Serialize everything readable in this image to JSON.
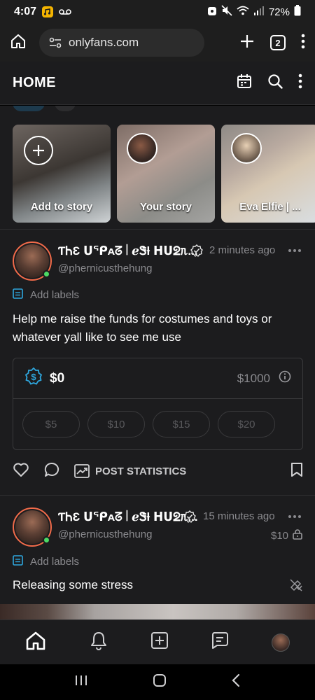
{
  "status_bar": {
    "time": "4:07",
    "battery": "72%"
  },
  "browser": {
    "url": "onlyfans.com",
    "tab_count": "2"
  },
  "header": {
    "title": "HOME"
  },
  "stories": [
    {
      "label": "Add to story"
    },
    {
      "label": "Your story"
    },
    {
      "label": "Eva Elfie | ..."
    }
  ],
  "posts": [
    {
      "display_name": "ƬᏂƐ ᑌᕿᴀᘔ꒐ℯᏕƚ ᕼᑌᘖᥰ...",
      "handle": "@phernicusthehung",
      "time": "2 minutes ago",
      "add_labels": "Add labels",
      "text": "Help me raise the funds for costumes and toys or whatever yall like to see me use",
      "fundraiser": {
        "raised": "$0",
        "goal": "$1000",
        "tips": [
          "$5",
          "$10",
          "$15",
          "$20"
        ]
      },
      "stats_label": "POST STATISTICS"
    },
    {
      "display_name": "ƬᏂƐ ᑌᕿᴀᘔ꒐ℯᏕƚ ᕼᑌᘖᥰ...",
      "handle": "@phernicusthehung",
      "time": "15 minutes ago",
      "price": "$10",
      "add_labels": "Add labels",
      "text": "Releasing some stress"
    }
  ],
  "tabbar": {
    "items": [
      "home-icon",
      "bell-icon",
      "add-post-icon",
      "messages-icon",
      "profile-avatar"
    ]
  },
  "colors": {
    "accent": "#2ea7de",
    "online": "#4cd964",
    "avatar_ring": "#f26b4a",
    "background": "#1c1c1e"
  }
}
